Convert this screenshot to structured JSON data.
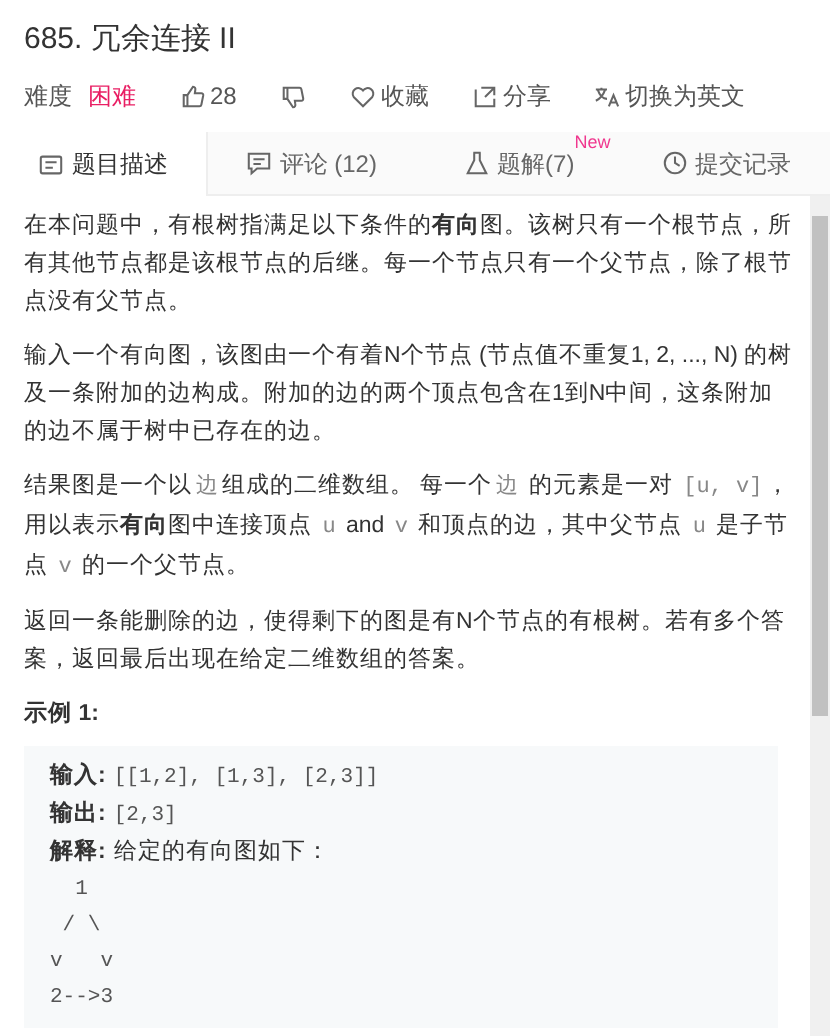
{
  "title": "685. 冗余连接 II",
  "meta": {
    "difficulty_label": "难度",
    "difficulty": "困难",
    "likes": "28",
    "favorite": "收藏",
    "share": "分享",
    "translate": "切换为英文"
  },
  "tabs": [
    {
      "label": "题目描述",
      "selected": true
    },
    {
      "label": "评论 (12)",
      "selected": false
    },
    {
      "label": "题解(7)",
      "selected": false,
      "badge": "New"
    },
    {
      "label": "提交记录",
      "selected": false
    }
  ],
  "paragraphs": [
    [
      {
        "kind": "text",
        "text": "在本问题中，有根树指满足以下条件的"
      },
      {
        "kind": "bold",
        "text": "有向"
      },
      {
        "kind": "text",
        "text": "图。该树只有一个根节点，所有其他节点都是该根节点的后继。每一个节点只有一个父节点，除了根节点没有父节点。"
      }
    ],
    [
      {
        "kind": "text",
        "text": "输入一个有向图，该图由一个有着N个节点 (节点值不重复1, 2, ..., N) 的树及一条附加的边构成。附加的边的两个顶点包含在1到N中间，这条附加的边不属于树中已存在的边。"
      }
    ],
    [
      {
        "kind": "text",
        "text": "结果图是一个以"
      },
      {
        "kind": "code",
        "text": "边"
      },
      {
        "kind": "text",
        "text": "组成的二维数组。 每一个"
      },
      {
        "kind": "code",
        "text": "边"
      },
      {
        "kind": "text",
        "text": " 的元素是一对 "
      },
      {
        "kind": "code",
        "text": "[u, v]"
      },
      {
        "kind": "text",
        "text": "，用以表示"
      },
      {
        "kind": "bold",
        "text": "有向"
      },
      {
        "kind": "text",
        "text": "图中连接顶点 "
      },
      {
        "kind": "code",
        "text": "u"
      },
      {
        "kind": "text",
        "text": " and "
      },
      {
        "kind": "code",
        "text": "v"
      },
      {
        "kind": "text",
        "text": " 和顶点的边，其中父节点 "
      },
      {
        "kind": "code",
        "text": "u"
      },
      {
        "kind": "text",
        "text": " 是子节点 "
      },
      {
        "kind": "code",
        "text": "v"
      },
      {
        "kind": "text",
        "text": " 的一个父节点。"
      }
    ],
    [
      {
        "kind": "text",
        "text": "返回一条能删除的边，使得剩下的图是有N个节点的有根树。若有多个答案，返回最后出现在给定二维数组的答案。"
      }
    ]
  ],
  "example": {
    "heading": "示例 1:",
    "lines": [
      {
        "kind": "code",
        "label": "输入:",
        "text": "[[1,2], [1,3], [2,3]]"
      },
      {
        "kind": "code",
        "label": "输出:",
        "text": "[2,3]"
      },
      {
        "kind": "prose",
        "label": "解释:",
        "text": "给定的有向图如下："
      },
      {
        "kind": "code",
        "text": "  1"
      },
      {
        "kind": "code",
        "text": " / \\"
      },
      {
        "kind": "code",
        "text": "v   v"
      },
      {
        "kind": "code",
        "text": "2-->3"
      }
    ]
  }
}
